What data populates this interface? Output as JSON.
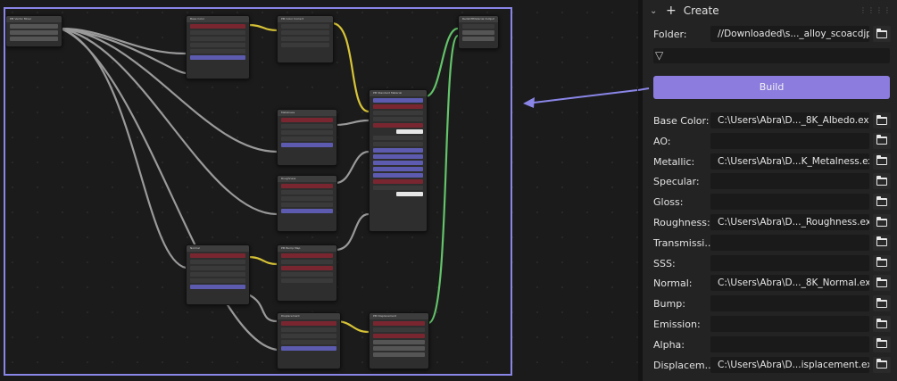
{
  "graph": {
    "nodes": [
      {
        "id": "tex-coord",
        "title": "PM Vector Mixer"
      },
      {
        "id": "base-color",
        "title": "Base Color"
      },
      {
        "id": "color-correct",
        "title": "PM Color Correct"
      },
      {
        "id": "metalness",
        "title": "Metalness"
      },
      {
        "id": "roughness",
        "title": "Roughness"
      },
      {
        "id": "pbr",
        "title": "PM Standard Material"
      },
      {
        "id": "output",
        "title": "RedshiftMaterial Output"
      },
      {
        "id": "normal",
        "title": "Normal"
      },
      {
        "id": "bump",
        "title": "PM Bump Map"
      },
      {
        "id": "displacement",
        "title": "Displacement"
      },
      {
        "id": "disp-node",
        "title": "PM Displacement"
      }
    ]
  },
  "panel": {
    "title": "Create",
    "folder_label": "Folder:",
    "folder_value": "//Downloaded\\s..._alloy_scoacdjp\\",
    "build_label": "Build",
    "maps": [
      {
        "label": "Base Color:",
        "value": "C:\\Users\\Abra\\D..._8K_Albedo.exr"
      },
      {
        "label": "AO:",
        "value": ""
      },
      {
        "label": "Metallic:",
        "value": "C:\\Users\\Abra\\D...K_Metalness.exr"
      },
      {
        "label": "Specular:",
        "value": ""
      },
      {
        "label": "Gloss:",
        "value": ""
      },
      {
        "label": "Roughness:",
        "value": "C:\\Users\\Abra\\D..._Roughness.exr"
      },
      {
        "label": "Transmissi...",
        "value": ""
      },
      {
        "label": "SSS:",
        "value": ""
      },
      {
        "label": "Normal:",
        "value": "C:\\Users\\Abra\\D..._8K_Normal.exr"
      },
      {
        "label": "Bump:",
        "value": ""
      },
      {
        "label": "Emission:",
        "value": ""
      },
      {
        "label": "Alpha:",
        "value": ""
      },
      {
        "label": "Displacem...",
        "value": "C:\\Users\\Abra\\D...isplacement.exr"
      }
    ]
  }
}
